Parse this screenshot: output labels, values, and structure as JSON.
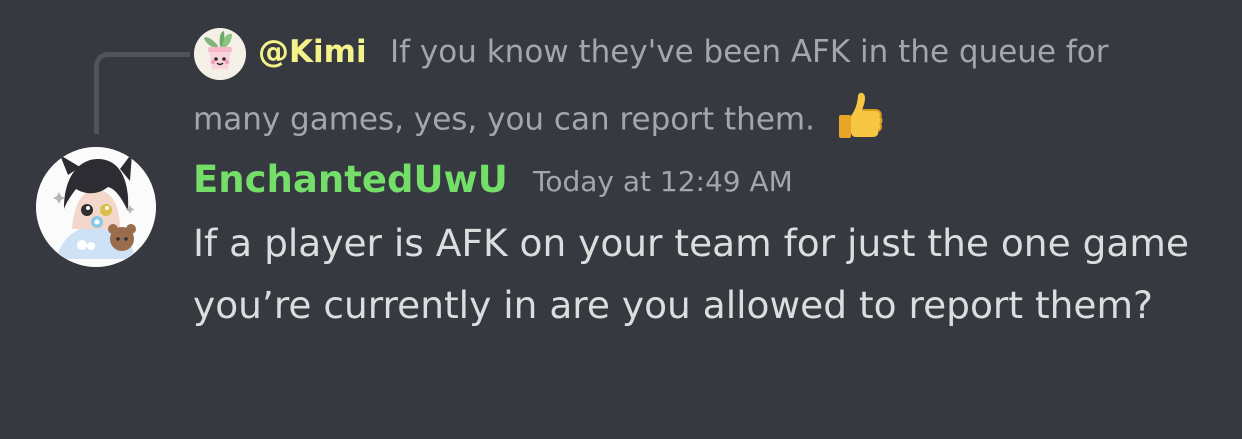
{
  "reply": {
    "author": "@Kimi",
    "author_color": "#f4f28a",
    "line1": "If you know they've been AFK in the queue for",
    "line2": "many games, yes, you can report them.",
    "emoji": "thumbs-up-icon"
  },
  "message": {
    "author": "EnchantedUwU",
    "author_color": "#74df68",
    "timestamp": "Today at 12:49 AM",
    "text": "If a player is AFK on your team for just the one game you’re currently in are you allowed to report them?"
  },
  "colors": {
    "background": "#36393f",
    "muted_text": "#a3a6aa",
    "message_text": "#dcddde"
  }
}
